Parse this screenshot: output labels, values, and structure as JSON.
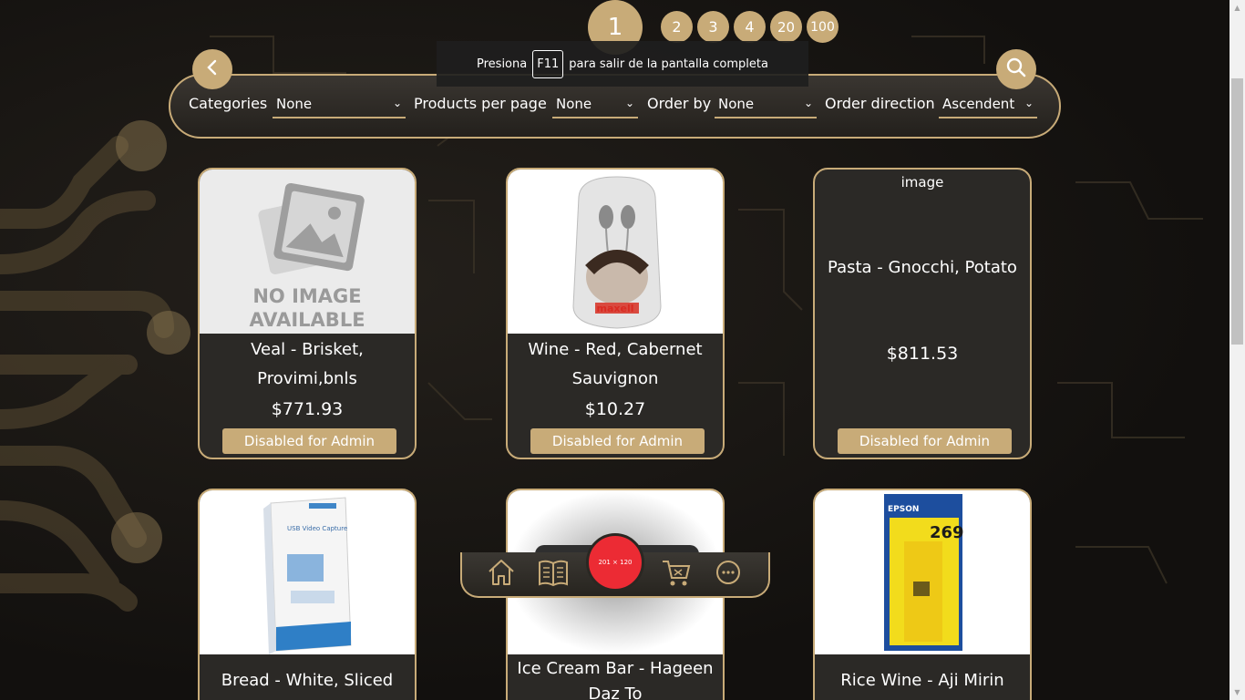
{
  "pagination": {
    "pages": [
      "1",
      "2",
      "3",
      "4",
      "20",
      "100"
    ],
    "current": "1"
  },
  "toast": {
    "before": "Presiona",
    "key": "F11",
    "after": "para salir de la pantalla completa"
  },
  "filters": {
    "categories_label": "Categories",
    "categories_value": "None",
    "per_page_label": "Products per page",
    "per_page_value": "None",
    "order_by_label": "Order by",
    "order_by_value": "None",
    "order_dir_label": "Order direction",
    "order_dir_value": "Ascendent"
  },
  "icons": {
    "back": "chevron-left-icon",
    "search": "search-icon",
    "home": "home-icon",
    "catalog": "book-icon",
    "cart": "cart-icon",
    "chat": "chat-icon"
  },
  "products": [
    {
      "title": "Veal - Brisket, Provimi,bnls",
      "price": "$771.93",
      "button": "Disabled for Admin",
      "image_text_1": "NO IMAGE",
      "image_text_2": "AVAILABLE"
    },
    {
      "title": "Wine - Red, Cabernet Sauvignon",
      "price": "$10.27",
      "button": "Disabled for Admin",
      "image_text": "maxell"
    },
    {
      "title": "Pasta - Gnocchi, Potato",
      "price": "$811.53",
      "button": "Disabled for Admin",
      "image_alt": "image"
    },
    {
      "title": "Bread - White, Sliced",
      "image_text": "USB Video Capture"
    },
    {
      "title": "Ice Cream Bar - Hageen Daz To"
    },
    {
      "title": "Rice Wine - Aji Mirin",
      "image_text_1": "EPSON",
      "image_text_2": "269"
    }
  ],
  "nav": {
    "center_label": "201 × 120"
  },
  "colors": {
    "accent": "#c8ab78",
    "background": "#141210",
    "card": "#2b2926",
    "center": "#ec2b34"
  }
}
